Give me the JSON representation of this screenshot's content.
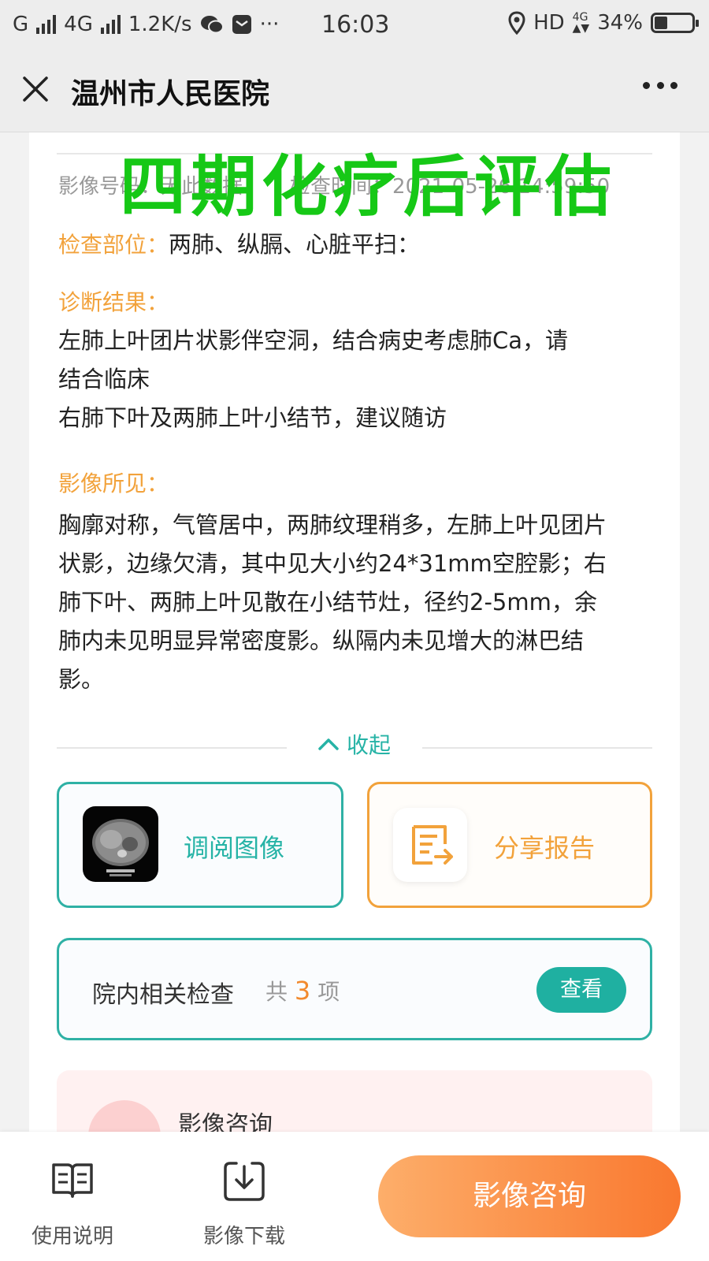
{
  "status_bar": {
    "left_text": "G",
    "network": "4G",
    "speed": "1.2K/s",
    "time": "16:03",
    "hd": "HD",
    "battery": "34%",
    "more": "···"
  },
  "title_bar": {
    "title": "温州市人民医院"
  },
  "overlay": {
    "text": "四期化疗后评估"
  },
  "report": {
    "image_no_label": "影像号码：",
    "image_no_value": "无此数据",
    "exam_time_label": "检查时间：",
    "exam_time_value": "2021-05-26 14:59:50",
    "exam_part_label": "检查部位：",
    "exam_part_value": "两肺、纵膈、心脏平扫：",
    "diagnosis_label": "诊断结果：",
    "diagnosis_lines": [
      "左肺上叶团片状影伴空洞，结合病史考虑肺Ca，请",
      "结合临床",
      "右肺下叶及两肺上叶小结节，建议随访"
    ],
    "findings_label": "影像所见：",
    "findings_lines": [
      "胸廓对称，气管居中，两肺纹理稍多，左肺上叶见团片",
      "状影，边缘欠清，其中见大小约24*31mm空腔影；右",
      "肺下叶、两肺上叶见散在小结节灶，径约2-5mm，余",
      "肺内未见明显异常密度影。纵隔内未见增大的淋巴结",
      "影。"
    ],
    "collapse_label": "收起"
  },
  "actions": {
    "view_images": "调阅图像",
    "share_report": "分享报告"
  },
  "related": {
    "title": "院内相关检查",
    "count_prefix": "共",
    "count": "3",
    "count_suffix": "项",
    "view_button": "查看"
  },
  "consult_card": {
    "title": "影像咨询"
  },
  "bottom_bar": {
    "manual": "使用说明",
    "download": "影像下载",
    "consult": "影像咨询"
  },
  "colors": {
    "accent_teal": "#26b3a6",
    "label_orange": "#f2a23b",
    "overlay_green": "#16c816",
    "consult_gradient_start": "#fdae6a",
    "consult_gradient_end": "#f9782f"
  },
  "icons": [
    "close-icon",
    "more-icon",
    "location-icon",
    "wechat-icon",
    "message-icon",
    "battery-icon",
    "chevron-up-icon",
    "share-report-icon",
    "book-icon",
    "download-icon"
  ]
}
